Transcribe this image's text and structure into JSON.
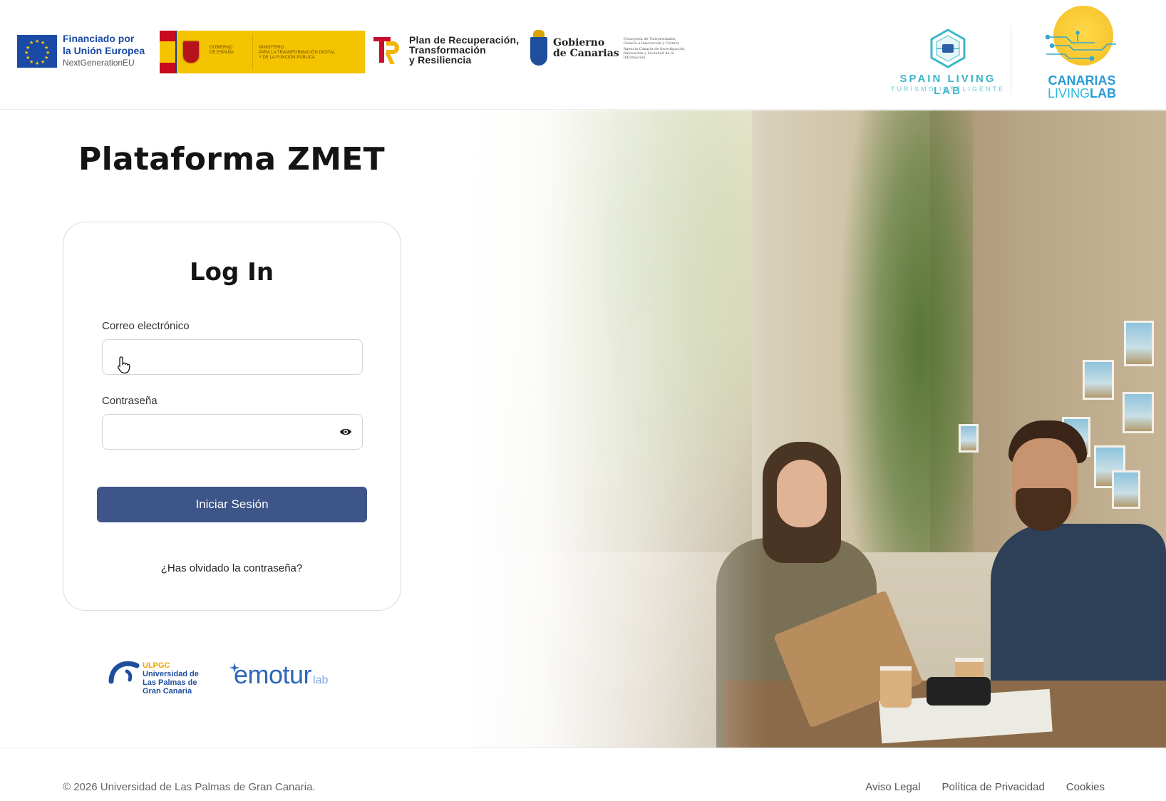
{
  "header": {
    "eu_logo": {
      "line1": "Financiado por",
      "line2": "la Unión Europea",
      "line3": "NextGenerationEU"
    },
    "spain_gov_logo": {
      "line1": "GOBIERNO",
      "line2": "DE ESPAÑA",
      "line3": "MINISTERIO",
      "line4": "PARA LA TRANSFORMACIÓN DIGITAL",
      "line5": "Y DE LA FUNCIÓN PÚBLICA"
    },
    "prtr_logo": {
      "line1": "Plan de Recuperación,",
      "line2": "Transformación",
      "line3": "y Resiliencia"
    },
    "gobcan_logo": {
      "line1": "Gobierno",
      "line2": "de Canarias",
      "small1": "Consejería de Universidades, Ciencia e Innovación y Cultura",
      "small2": "Agencia Canaria de Investigación, Innovación y Sociedad de la Información"
    },
    "spain_living_lab": {
      "title": "SPAIN LIVING LAB",
      "subtitle": "TURISMO INTELIGENTE"
    },
    "canarias_living_lab": {
      "line1": "CANARIAS",
      "line2a": "LIVING",
      "line2b": "LAB"
    }
  },
  "main": {
    "page_title": "Plataforma ZMET",
    "login": {
      "title": "Log In",
      "email_label": "Correo electrónico",
      "email_value": "",
      "password_label": "Contraseña",
      "password_value": "",
      "submit_label": "Iniciar Sesión",
      "forgot_label": "¿Has olvidado la contraseña?"
    },
    "partner_logos": {
      "ulpgc": {
        "acronym": "ULPGC",
        "line1": "Universidad de",
        "line2": "Las Palmas de",
        "line3": "Gran Canaria"
      },
      "emotur": {
        "main": "emotur",
        "suffix": "lab"
      }
    }
  },
  "footer": {
    "copyright": "© 2026 Universidad de Las Palmas de Gran Canaria.",
    "links": [
      "Aviso Legal",
      "Política de Privacidad",
      "Cookies"
    ]
  },
  "icons": {
    "eye": "eye-icon",
    "cursor": "hand-pointer-icon"
  },
  "colors": {
    "primary_button": "#3d5588",
    "eu_blue": "#1a4aa6",
    "living_lab_teal": "#3cb6c8"
  }
}
